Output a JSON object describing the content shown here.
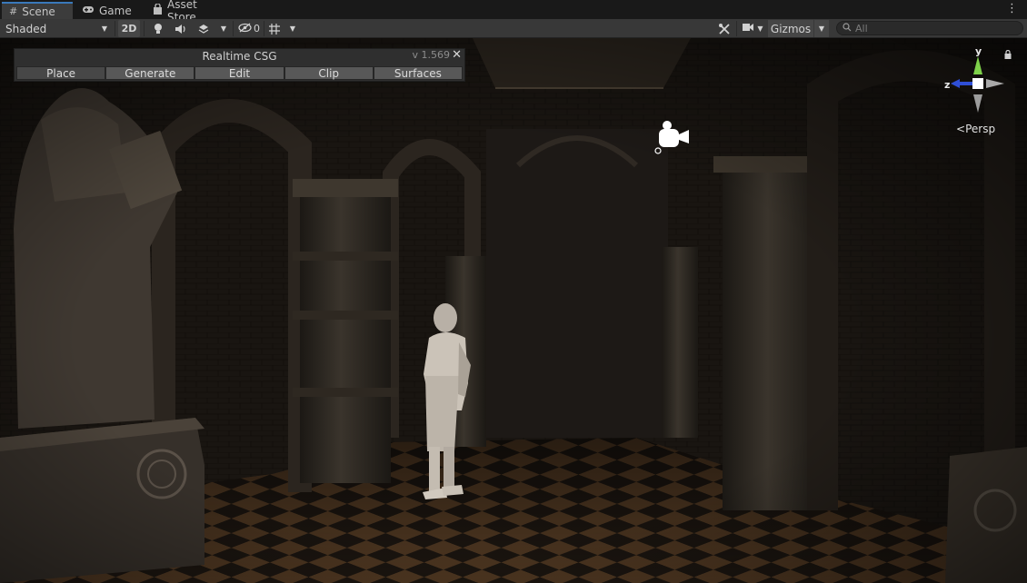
{
  "tabs": [
    {
      "label": "Scene",
      "icon": "grid-icon"
    },
    {
      "label": "Game",
      "icon": "gamepad-icon"
    },
    {
      "label": "Asset Store",
      "icon": "shopping-bag-icon"
    }
  ],
  "toolbar": {
    "draw_mode": "Shaded",
    "mode_2d": "2D",
    "hidden_count": "0",
    "gizmos_label": "Gizmos",
    "search_placeholder": "All"
  },
  "csg_panel": {
    "title": "Realtime CSG",
    "version": "v 1.569",
    "tabs": [
      "Place",
      "Generate",
      "Edit",
      "Clip",
      "Surfaces"
    ],
    "active_tab": "Place"
  },
  "orientation_gizmo": {
    "axis_y": "y",
    "axis_z": "z",
    "projection": "Persp"
  },
  "colors": {
    "accent": "#3a79bb",
    "axis_y": "#7ed14a",
    "axis_z": "#2f4fd6"
  }
}
